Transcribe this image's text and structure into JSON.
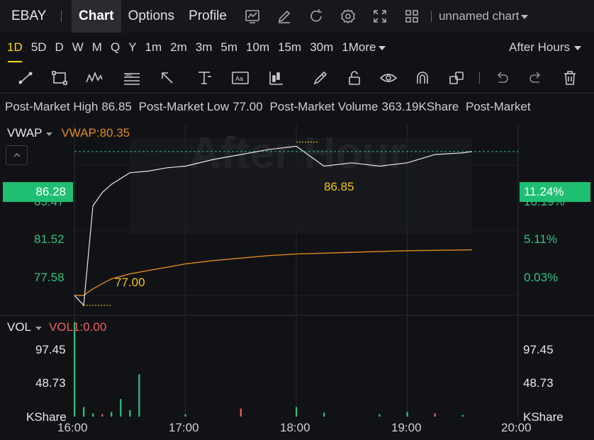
{
  "header": {
    "ticker": "EBAY",
    "tabs": [
      "Chart",
      "Options",
      "Profile"
    ],
    "icons": [
      "chart-type-icon",
      "edit-icon",
      "refresh-icon",
      "settings-icon",
      "fullscreen-icon",
      "layout-grid-icon"
    ],
    "chart_name": "unnamed chart"
  },
  "periods": [
    "1D",
    "5D",
    "D",
    "W",
    "M",
    "Q",
    "Y",
    "1m",
    "2m",
    "3m",
    "5m",
    "10m",
    "15m",
    "30m",
    "1More"
  ],
  "active_period": "1D",
  "session": "After Hours",
  "drawing_tools": [
    "trend-line-icon",
    "rectangle-icon",
    "pattern-icon",
    "fibonacci-icon",
    "arrow-icon",
    "price-range-icon",
    "text-annotation-icon",
    "position-icon",
    "brush-icon",
    "lock-icon",
    "eye-icon",
    "magnet-icon",
    "clone-icon",
    "undo-icon",
    "redo-icon",
    "trash-icon"
  ],
  "stats": {
    "high_label": "Post-Market High",
    "high_value": "86.85",
    "low_label": "Post-Market Low",
    "low_value": "77.00",
    "volume_label": "Post-Market Volume",
    "volume_value": "363.19KShare",
    "extra_label": "Post-Market"
  },
  "price_panel": {
    "indicator": "VWAP",
    "indicator_value": "VWAP:80.35",
    "watermark": "After Hour",
    "current_price": "86.28",
    "current_pct": "11.24%",
    "left_labels": [
      "85.47",
      "81.52",
      "77.58"
    ],
    "right_labels": [
      "10.19%",
      "5.11%",
      "0.03%"
    ],
    "high_annotation": "86.85",
    "low_annotation": "77.00"
  },
  "volume_panel": {
    "indicator": "VOL",
    "indicator_value": "VOL1:0.00",
    "left_labels": [
      "97.45",
      "48.73",
      "KShare"
    ],
    "right_labels": [
      "97.45",
      "48.73",
      "KShare"
    ]
  },
  "time_labels": [
    "16:00",
    "17:00",
    "18:00",
    "19:00",
    "20:00"
  ],
  "colors": {
    "up": "#2ec27e",
    "down": "#f0605a",
    "vwap": "#e08a1e",
    "highlight": "#ffd700",
    "price_line": "#e8e8e8"
  },
  "chart_data": {
    "type": "line",
    "x": [
      "16:00",
      "16:05",
      "16:10",
      "16:15",
      "16:20",
      "16:30",
      "16:40",
      "16:50",
      "17:00",
      "17:15",
      "17:30",
      "17:45",
      "18:00",
      "18:15",
      "18:30",
      "18:45",
      "19:00",
      "19:15",
      "19:30",
      "19:35"
    ],
    "series": [
      {
        "values": [
          77.6,
          77.0,
          83.0,
          83.8,
          84.3,
          85.0,
          85.1,
          85.3,
          85.4,
          85.8,
          86.1,
          86.4,
          86.6,
          85.4,
          85.6,
          85.4,
          85.6,
          86.1,
          86.2,
          86.28
        ]
      },
      {
        "name": "VWAP",
        "values": [
          77.6,
          77.6,
          78.0,
          78.3,
          78.6,
          78.9,
          79.1,
          79.3,
          79.5,
          79.7,
          79.85,
          80.0,
          80.1,
          80.15,
          80.2,
          80.25,
          80.3,
          80.32,
          80.34,
          80.35
        ]
      }
    ],
    "ylim": [
      76.4,
      87.9
    ],
    "volume": {
      "x": [
        "16:00",
        "16:05",
        "16:10",
        "16:15",
        "16:20",
        "16:25",
        "16:30",
        "16:35",
        "17:00",
        "17:30",
        "18:00",
        "18:15",
        "18:45",
        "19:00",
        "19:15",
        "19:30"
      ],
      "values": [
        118,
        12,
        4,
        3,
        6,
        22,
        8,
        53,
        3,
        10,
        12,
        5,
        3,
        6,
        4,
        2
      ],
      "down": [
        false,
        false,
        false,
        true,
        false,
        false,
        false,
        false,
        false,
        true,
        false,
        false,
        false,
        false,
        true,
        false
      ],
      "ylim": [
        0,
        125
      ]
    }
  }
}
